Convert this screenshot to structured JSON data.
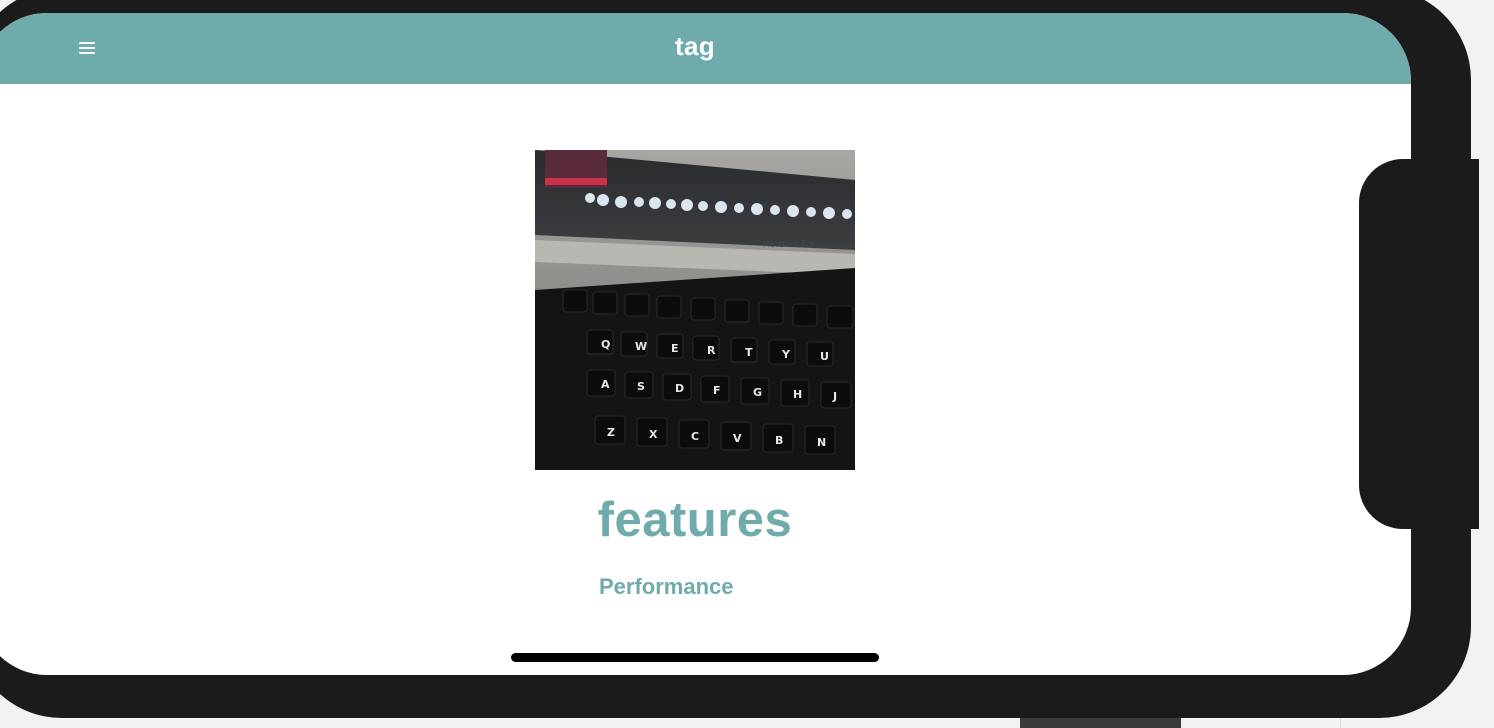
{
  "app": {
    "title": "tag",
    "menu_icon": "hamburger-menu-icon",
    "accent_color": "#70abab"
  },
  "content": {
    "image_description_icon": "laptop-keyboard-photo",
    "heading": "features",
    "link_label": "Performance"
  }
}
